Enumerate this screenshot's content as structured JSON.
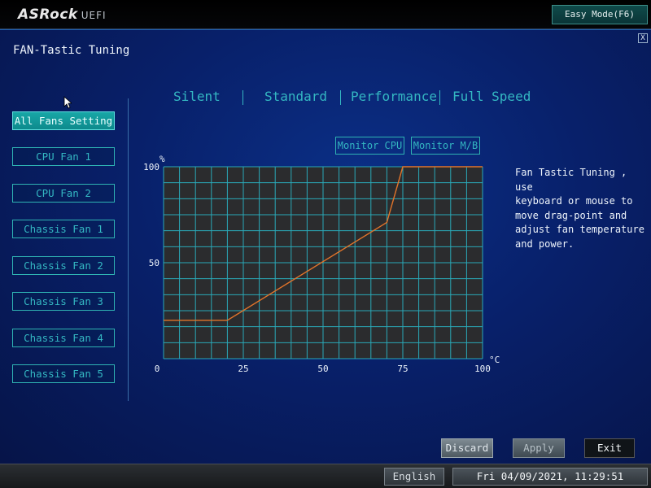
{
  "header": {
    "logo_brand": "ASRock",
    "logo_suffix": "UEFI",
    "easy_mode_label": "Easy Mode(F6)"
  },
  "page": {
    "title": "FAN-Tastic Tuning",
    "close_label": "X"
  },
  "fan_list": [
    {
      "label": "All Fans Setting",
      "active": true
    },
    {
      "label": "CPU Fan 1",
      "active": false
    },
    {
      "label": "CPU Fan 2",
      "active": false
    },
    {
      "label": "Chassis Fan 1",
      "active": false
    },
    {
      "label": "Chassis Fan 2",
      "active": false
    },
    {
      "label": "Chassis Fan 3",
      "active": false
    },
    {
      "label": "Chassis Fan 4",
      "active": false
    },
    {
      "label": "Chassis Fan 5",
      "active": false
    }
  ],
  "presets": [
    "Silent",
    "Standard",
    "Performance",
    "Full Speed"
  ],
  "monitor": {
    "cpu_label": "Monitor CPU",
    "mb_label": "Monitor M/B"
  },
  "chart_data": {
    "type": "line",
    "xlabel": "°C",
    "ylabel": "%",
    "xlim": [
      0,
      100
    ],
    "ylim": [
      0,
      100
    ],
    "x_ticks": [
      0,
      25,
      50,
      75,
      100
    ],
    "y_ticks": [
      100,
      50
    ],
    "grid": true,
    "series": [
      {
        "points": [
          [
            0,
            20
          ],
          [
            20,
            20
          ],
          [
            70,
            71
          ],
          [
            75,
            100
          ],
          [
            100,
            100
          ]
        ]
      }
    ]
  },
  "help_text": "Fan Tastic Tuning , use\nkeyboard or mouse to\nmove drag-point and\nadjust fan temperature\nand power.",
  "actions": {
    "discard_label": "Discard",
    "apply_label": "Apply",
    "exit_label": "Exit"
  },
  "status": {
    "language": "English",
    "datetime": "Fri 04/09/2021, 11:29:51"
  },
  "colors": {
    "accent": "#34b7c2",
    "curve": "#e2742a",
    "grid": "#2aa9b8",
    "plot_bg": "#2b2c2e"
  }
}
